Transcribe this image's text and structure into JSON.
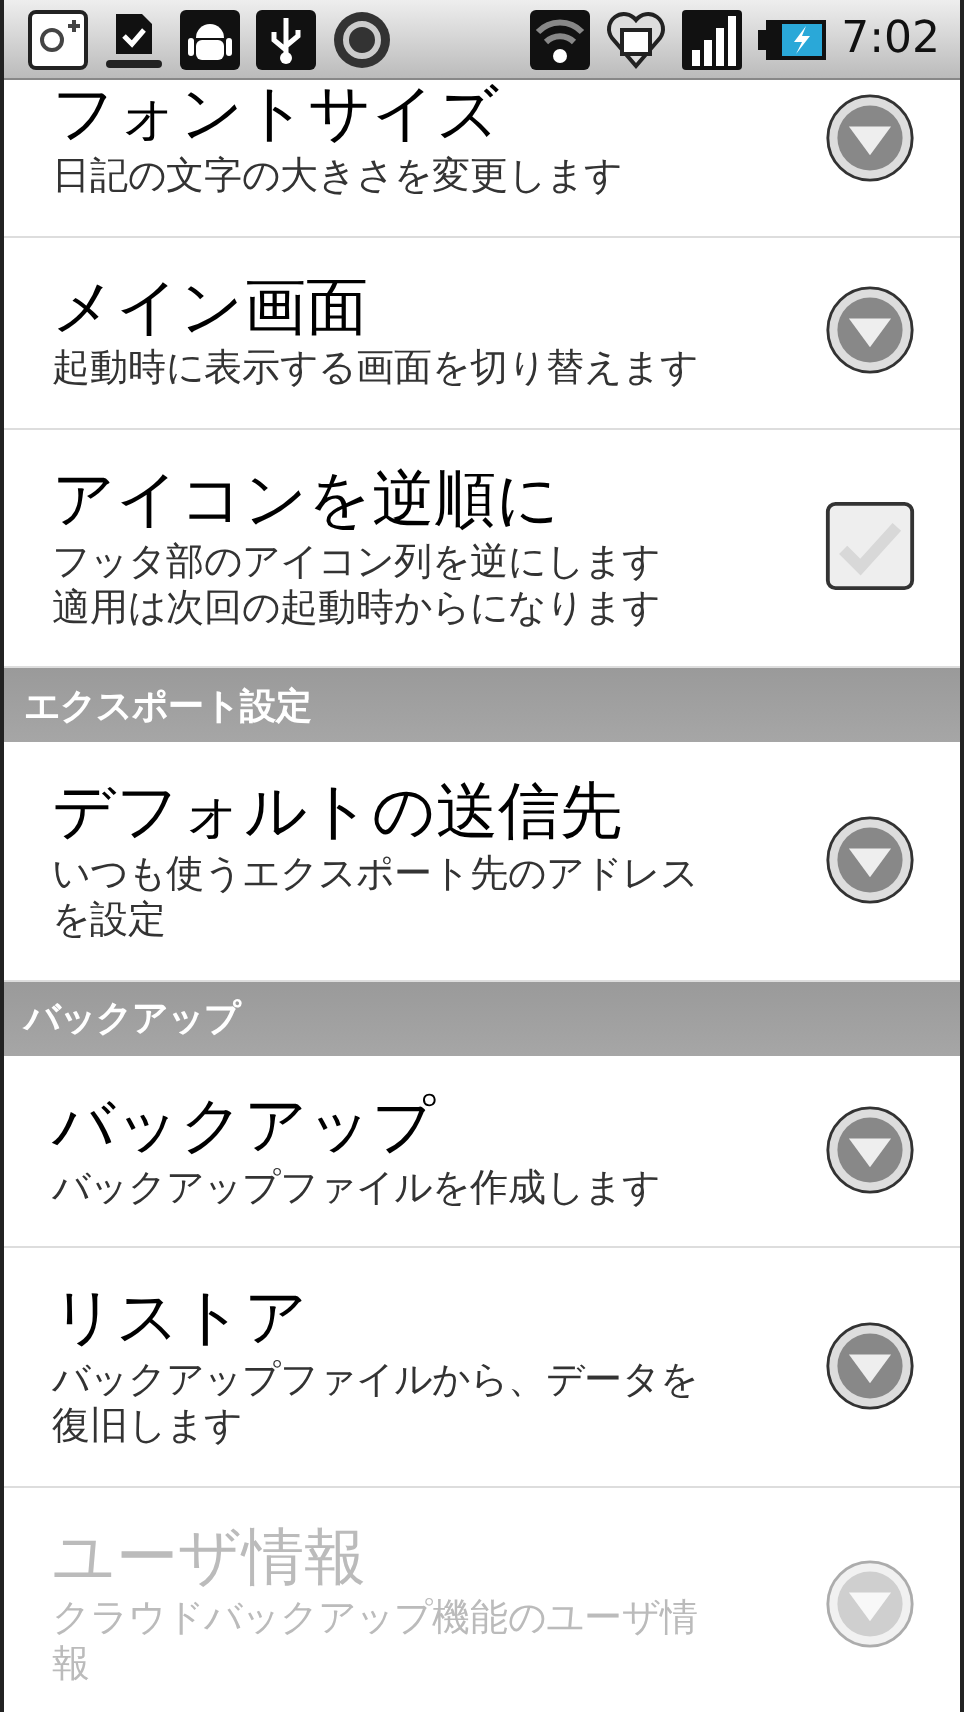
{
  "status_bar": {
    "time": "7:02"
  },
  "items": [
    {
      "kind": "dropdown",
      "title": "フォントサイズ",
      "summary": [
        "日記の文字の大きさを変更します"
      ],
      "disabled": false
    },
    {
      "kind": "dropdown",
      "title": "メイン画面",
      "summary": [
        "起動時に表示する画面を切り替えます"
      ],
      "disabled": false
    },
    {
      "kind": "checkbox",
      "title": "アイコンを逆順に",
      "summary": [
        "フッタ部のアイコン列を逆にします",
        "適用は次回の起動時からになります"
      ],
      "checked": false,
      "disabled": false
    },
    {
      "kind": "header",
      "title": "エクスポート設定"
    },
    {
      "kind": "dropdown",
      "title": "デフォルトの送信先",
      "summary": [
        "いつも使うエクスポート先のアドレス",
        "を設定"
      ],
      "disabled": false
    },
    {
      "kind": "header",
      "title": "バックアップ"
    },
    {
      "kind": "dropdown",
      "title": "バックアップ",
      "summary": [
        "バックアップファイルを作成します"
      ],
      "disabled": false
    },
    {
      "kind": "dropdown",
      "title": "リストア",
      "summary": [
        "バックアップファイルから、データを",
        "復旧します"
      ],
      "disabled": false
    },
    {
      "kind": "dropdown",
      "title": "ユーザ情報",
      "summary": [
        "クラウドバックアップ機能のユーザ情",
        "報"
      ],
      "disabled": true
    }
  ]
}
